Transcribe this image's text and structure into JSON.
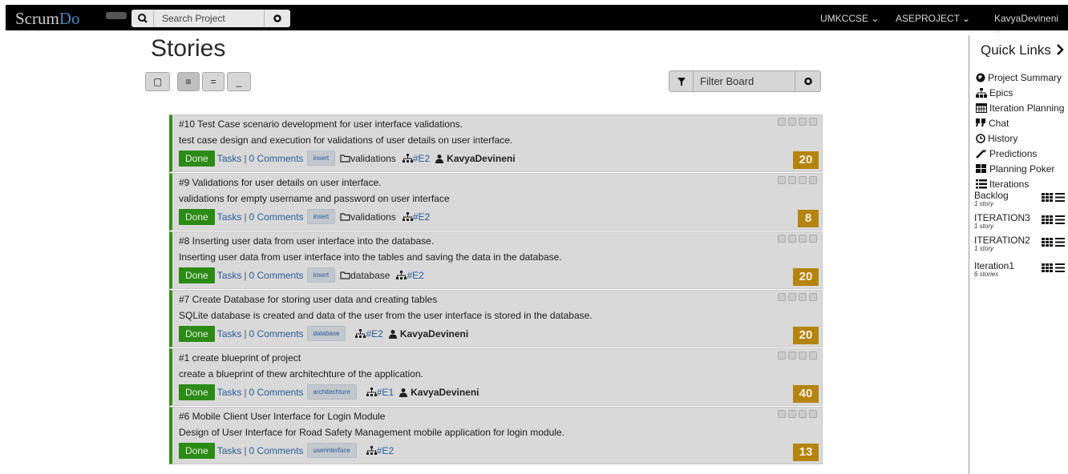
{
  "app": {
    "logo_main": "Scrum",
    "logo_accent": "Do"
  },
  "topbar": {
    "search_placeholder": "Search Project",
    "org": "UMKCCSE ⌄",
    "project": "ASEPROJECT ⌄",
    "user": "KavyaDevineni ⌄"
  },
  "page": {
    "title": "Stories",
    "view_buttons": [
      "▢",
      "≡",
      "=",
      "_"
    ],
    "filter_placeholder": "Filter Board"
  },
  "stories": [
    {
      "title": "#10 Test Case scenario development for user interface validations.",
      "description": "test case design and execution for validations of user details on user interface.",
      "status": "Done",
      "tasks": "Tasks",
      "comments": "0 Comments",
      "tag": "insert",
      "category": "validations",
      "epic": "#E2",
      "owner": "KavyaDevineni",
      "points": "20"
    },
    {
      "title": "#9 Validations for user details on user interface.",
      "description": "validations for empty username and password on user interface",
      "status": "Done",
      "tasks": "Tasks",
      "comments": "0 Comments",
      "tag": "insert",
      "category": "validations",
      "epic": "#E2",
      "owner": "",
      "points": "8"
    },
    {
      "title": "#8 Inserting user data from user interface into the database.",
      "description": "Inserting user data from user interface into the tables and saving the data in the database.",
      "status": "Done",
      "tasks": "Tasks",
      "comments": "0 Comments",
      "tag": "insert",
      "category": "database",
      "epic": "#E2",
      "owner": "",
      "points": "20"
    },
    {
      "title": "#7 Create Database for storing user data and creating tables",
      "description": "SQLite database is created and data of the user from the user interface is stored in the database.",
      "status": "Done",
      "tasks": "Tasks",
      "comments": "0 Comments",
      "tag": "database",
      "category": "",
      "epic": "#E2",
      "owner": "KavyaDevineni",
      "points": "20"
    },
    {
      "title": "#1 create blueprint of project",
      "description": "create a blueprint of thew architechture of the application.",
      "status": "Done",
      "tasks": "Tasks",
      "comments": "0 Comments",
      "tag": "architechture",
      "category": "",
      "epic": "#E1",
      "owner": "KavyaDevineni",
      "points": "40"
    },
    {
      "title": "#6 Mobile Client User Interface for Login Module",
      "description": "Design of User Interface for Road Safety Management mobile application for login module.",
      "status": "Done",
      "tasks": "Tasks",
      "comments": "0 Comments",
      "tag": "userinterface",
      "category": "",
      "epic": "#E2",
      "owner": "",
      "points": "13"
    }
  ],
  "sidebar": {
    "title": "Quick Links",
    "links": [
      "Project Summary",
      "Epics",
      "Iteration Planning",
      "Chat",
      "History",
      "Predictions",
      "Planning Poker",
      "Iterations"
    ],
    "iterations": [
      {
        "name": "Backlog",
        "count": "1 story"
      },
      {
        "name": "ITERATION3",
        "count": "1 story"
      },
      {
        "name": "ITERATION2",
        "count": "1 story"
      },
      {
        "name": "Iteration1",
        "count": "6 stories"
      }
    ]
  },
  "colors": {
    "done": "#2c8a16",
    "points": "#b5840e",
    "link": "#2a5d99",
    "topbar": "#000000"
  }
}
